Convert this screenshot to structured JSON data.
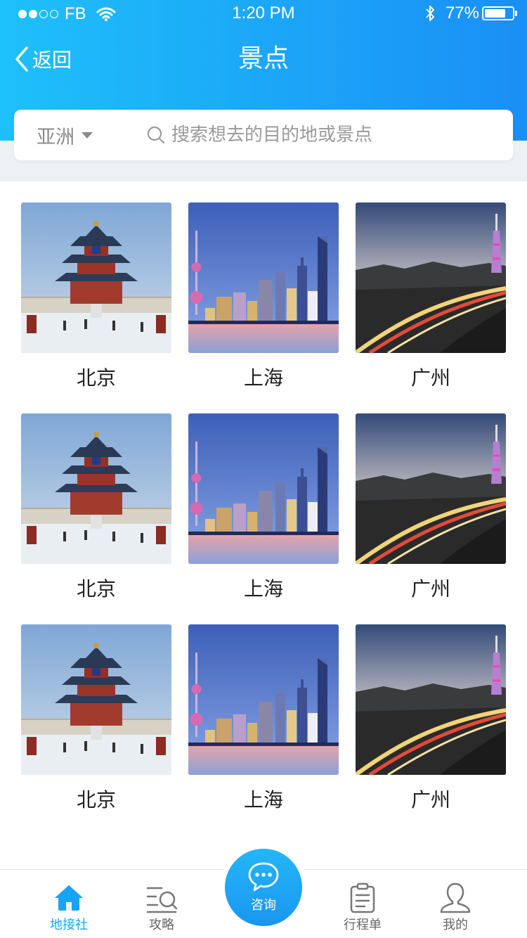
{
  "status_bar": {
    "carrier": "FB",
    "time": "1:20 PM",
    "battery_percent": "77%",
    "battery_level": 0.77,
    "signal_dots_filled": 2,
    "signal_dots_total": 5
  },
  "nav": {
    "back_label": "返回",
    "title": "景点"
  },
  "search": {
    "region": "亚洲",
    "placeholder": "搜索想去的目的地或景点"
  },
  "destinations": [
    {
      "name": "北京",
      "image": "temple-of-heaven"
    },
    {
      "name": "上海",
      "image": "shanghai-skyline"
    },
    {
      "name": "广州",
      "image": "guangzhou-canton-tower"
    },
    {
      "name": "北京",
      "image": "temple-of-heaven"
    },
    {
      "name": "上海",
      "image": "shanghai-skyline"
    },
    {
      "name": "广州",
      "image": "guangzhou-canton-tower"
    },
    {
      "name": "北京",
      "image": "temple-of-heaven"
    },
    {
      "name": "上海",
      "image": "shanghai-skyline"
    },
    {
      "name": "广州",
      "image": "guangzhou-canton-tower"
    }
  ],
  "tabbar": {
    "tabs": [
      {
        "label": "地接社",
        "icon": "home-icon",
        "active": true
      },
      {
        "label": "攻略",
        "icon": "guide-search-icon",
        "active": false
      },
      {
        "label": "咨询",
        "icon": "chat-bubble-icon",
        "active": false
      },
      {
        "label": "行程单",
        "icon": "clipboard-icon",
        "active": false
      },
      {
        "label": "我的",
        "icon": "user-icon",
        "active": false
      }
    ]
  },
  "colors": {
    "header_start": "#1ec0fb",
    "header_end": "#1a8ff5",
    "accent": "#1aa3f5",
    "band": "#edf0f4"
  }
}
